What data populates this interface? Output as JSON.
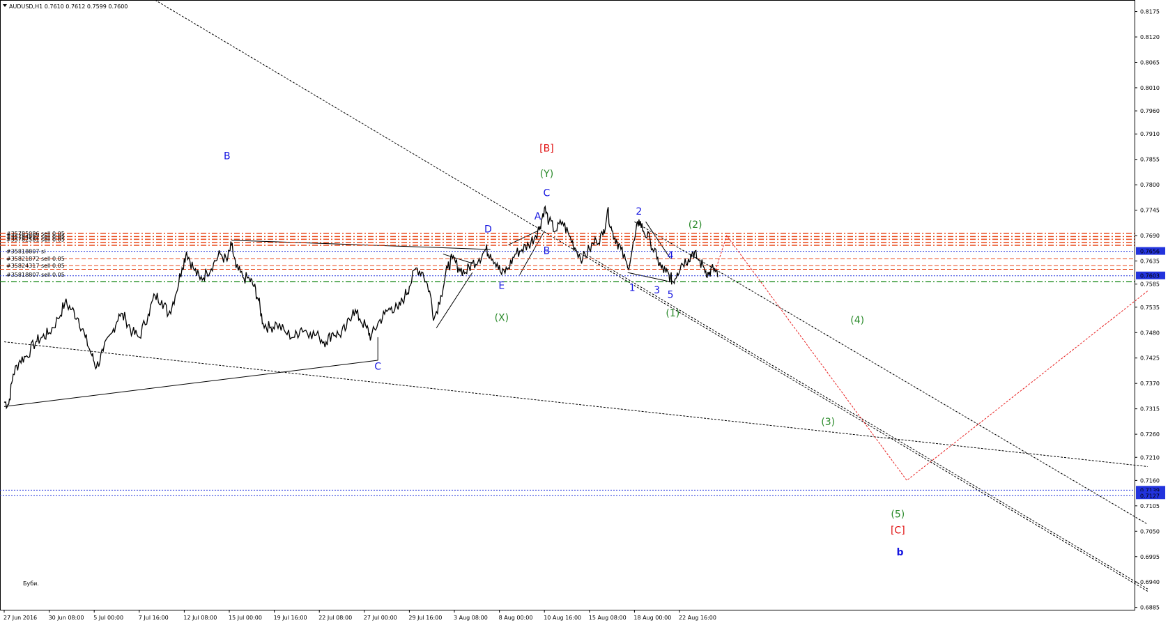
{
  "title": "AUDUSD,H1  0.7610 0.7612 0.7599 0.7600",
  "footer_note": "Буби.",
  "colors": {
    "background": "#ffffff",
    "price": "#000000",
    "blue_label": "#1515e0",
    "green_label": "#2a8a2a",
    "red_label": "#e01010",
    "order_line": "#e8481a",
    "sl_line": "#2233dd",
    "price_badge": "#2233dd",
    "green_dash": "#1a8a1a",
    "projection": "#e82020"
  },
  "chart_data": {
    "type": "line",
    "symbol": "AUDUSD",
    "timeframe": "H1",
    "ohlc": {
      "open": 0.761,
      "high": 0.7612,
      "low": 0.7599,
      "close": 0.76
    },
    "ylim": [
      0.688,
      0.82
    ],
    "grid": false,
    "y_ticks": [
      "0.8175",
      "0.8120",
      "0.8065",
      "0.8010",
      "0.7960",
      "0.7910",
      "0.7855",
      "0.7800",
      "0.7745",
      "0.7690",
      "0.7635",
      "0.7585",
      "0.7535",
      "0.7480",
      "0.7425",
      "0.7370",
      "0.7315",
      "0.7260",
      "0.7210",
      "0.7160",
      "0.7105",
      "0.7050",
      "0.6995",
      "0.6940",
      "0.6885"
    ],
    "x_ticks": [
      {
        "label": "27 Jun 2016",
        "t": 0
      },
      {
        "label": "30 Jun 08:00",
        "t": 1
      },
      {
        "label": "5 Jul 00:00",
        "t": 2
      },
      {
        "label": "7 Jul 16:00",
        "t": 3
      },
      {
        "label": "12 Jul 08:00",
        "t": 4
      },
      {
        "label": "15 Jul 00:00",
        "t": 5
      },
      {
        "label": "19 Jul 16:00",
        "t": 6
      },
      {
        "label": "22 Jul 08:00",
        "t": 7
      },
      {
        "label": "27 Jul 00:00",
        "t": 8
      },
      {
        "label": "29 Jul 16:00",
        "t": 9
      },
      {
        "label": "3 Aug 08:00",
        "t": 10
      },
      {
        "label": "8 Aug 00:00",
        "t": 11
      },
      {
        "label": "10 Aug 16:00",
        "t": 12
      },
      {
        "label": "15 Aug 08:00",
        "t": 13
      },
      {
        "label": "18 Aug 00:00",
        "t": 14
      },
      {
        "label": "22 Aug 16:00",
        "t": 15
      }
    ],
    "price_path": [
      [
        0.0,
        0.733
      ],
      [
        0.1,
        0.7325
      ],
      [
        0.2,
        0.739
      ],
      [
        0.35,
        0.742
      ],
      [
        0.5,
        0.743
      ],
      [
        0.7,
        0.746
      ],
      [
        0.85,
        0.747
      ],
      [
        1.0,
        0.748
      ],
      [
        1.2,
        0.751
      ],
      [
        1.35,
        0.7545
      ],
      [
        1.5,
        0.753
      ],
      [
        1.65,
        0.751
      ],
      [
        1.8,
        0.747
      ],
      [
        1.95,
        0.743
      ],
      [
        2.05,
        0.7405
      ],
      [
        2.2,
        0.744
      ],
      [
        2.4,
        0.748
      ],
      [
        2.55,
        0.752
      ],
      [
        2.7,
        0.751
      ],
      [
        2.85,
        0.748
      ],
      [
        3.0,
        0.747
      ],
      [
        3.2,
        0.752
      ],
      [
        3.35,
        0.756
      ],
      [
        3.5,
        0.755
      ],
      [
        3.65,
        0.752
      ],
      [
        3.8,
        0.756
      ],
      [
        3.95,
        0.762
      ],
      [
        4.05,
        0.7655
      ],
      [
        4.2,
        0.762
      ],
      [
        4.35,
        0.7595
      ],
      [
        4.5,
        0.761
      ],
      [
        4.65,
        0.763
      ],
      [
        4.8,
        0.765
      ],
      [
        4.95,
        0.7635
      ],
      [
        5.05,
        0.767
      ],
      [
        5.15,
        0.762
      ],
      [
        5.3,
        0.76
      ],
      [
        5.45,
        0.7595
      ],
      [
        5.55,
        0.758
      ],
      [
        5.65,
        0.755
      ],
      [
        5.75,
        0.75
      ],
      [
        5.9,
        0.749
      ],
      [
        6.05,
        0.75
      ],
      [
        6.25,
        0.748
      ],
      [
        6.45,
        0.747
      ],
      [
        6.6,
        0.749
      ],
      [
        6.8,
        0.748
      ],
      [
        7.0,
        0.747
      ],
      [
        7.15,
        0.746
      ],
      [
        7.3,
        0.748
      ],
      [
        7.45,
        0.7475
      ],
      [
        7.6,
        0.749
      ],
      [
        7.75,
        0.753
      ],
      [
        7.9,
        0.751
      ],
      [
        8.05,
        0.749
      ],
      [
        8.15,
        0.747
      ],
      [
        8.3,
        0.75
      ],
      [
        8.45,
        0.752
      ],
      [
        8.6,
        0.7535
      ],
      [
        8.75,
        0.753
      ],
      [
        8.9,
        0.756
      ],
      [
        9.0,
        0.758
      ],
      [
        9.15,
        0.762
      ],
      [
        9.3,
        0.761
      ],
      [
        9.45,
        0.757
      ],
      [
        9.55,
        0.751
      ],
      [
        9.7,
        0.756
      ],
      [
        9.85,
        0.762
      ],
      [
        9.95,
        0.764
      ],
      [
        10.1,
        0.762
      ],
      [
        10.25,
        0.761
      ],
      [
        10.4,
        0.763
      ],
      [
        10.55,
        0.764
      ],
      [
        10.7,
        0.766
      ],
      [
        10.8,
        0.765
      ],
      [
        10.95,
        0.763
      ],
      [
        11.05,
        0.7605
      ],
      [
        11.2,
        0.762
      ],
      [
        11.35,
        0.765
      ],
      [
        11.5,
        0.766
      ],
      [
        11.65,
        0.767
      ],
      [
        11.8,
        0.769
      ],
      [
        11.9,
        0.771
      ],
      [
        12.0,
        0.775
      ],
      [
        12.1,
        0.772
      ],
      [
        12.25,
        0.77
      ],
      [
        12.4,
        0.772
      ],
      [
        12.55,
        0.769
      ],
      [
        12.7,
        0.766
      ],
      [
        12.85,
        0.764
      ],
      [
        13.0,
        0.766
      ],
      [
        13.15,
        0.768
      ],
      [
        13.3,
        0.769
      ],
      [
        13.4,
        0.7745
      ],
      [
        13.5,
        0.77
      ],
      [
        13.6,
        0.768
      ],
      [
        13.7,
        0.766
      ],
      [
        13.85,
        0.762
      ],
      [
        14.0,
        0.768
      ],
      [
        14.1,
        0.7725
      ],
      [
        14.2,
        0.77
      ],
      [
        14.35,
        0.768
      ],
      [
        14.5,
        0.764
      ],
      [
        14.6,
        0.762
      ],
      [
        14.7,
        0.761
      ],
      [
        14.8,
        0.76
      ],
      [
        14.85,
        0.759
      ],
      [
        14.95,
        0.761
      ],
      [
        15.05,
        0.763
      ],
      [
        15.2,
        0.764
      ],
      [
        15.3,
        0.7655
      ],
      [
        15.4,
        0.764
      ],
      [
        15.55,
        0.762
      ],
      [
        15.65,
        0.7605
      ],
      [
        15.75,
        0.762
      ],
      [
        15.85,
        0.76
      ]
    ],
    "horizontal_lines": [
      {
        "kind": "order",
        "price": 0.7695,
        "style": "dashdot"
      },
      {
        "kind": "order",
        "price": 0.7688,
        "style": "dashdot"
      },
      {
        "kind": "order",
        "price": 0.7682,
        "style": "dashdot"
      },
      {
        "kind": "order",
        "price": 0.7675,
        "style": "dashdot"
      },
      {
        "kind": "order",
        "price": 0.7669,
        "style": "dashdot"
      },
      {
        "kind": "order",
        "price": 0.764,
        "style": "dash"
      },
      {
        "kind": "order",
        "price": 0.7625,
        "style": "dash"
      },
      {
        "kind": "order",
        "price": 0.7617,
        "style": "dash"
      },
      {
        "kind": "sl",
        "price": 0.7656,
        "style": "dot"
      },
      {
        "kind": "sl",
        "price": 0.7603,
        "style": "dot"
      },
      {
        "kind": "green",
        "price": 0.759,
        "style": "dashdot"
      },
      {
        "kind": "sl",
        "price": 0.7139,
        "style": "dot"
      },
      {
        "kind": "sl",
        "price": 0.7127,
        "style": "dot"
      }
    ],
    "price_badges": [
      {
        "label": "0.7656",
        "price": 0.7656
      },
      {
        "label": "0.7603",
        "price": 0.7603
      },
      {
        "label": "0.7139",
        "price": 0.7139
      },
      {
        "label": "0.7127",
        "price": 0.7127
      }
    ],
    "order_labels": [
      {
        "text": "#35785086 sell 0.05",
        "price": 0.7695
      },
      {
        "text": "#35784992 sell 0.05",
        "price": 0.7688
      },
      {
        "text": "#35782581 sell 0.05",
        "price": 0.7682
      },
      {
        "text": "#35818807 sl",
        "price": 0.7656
      },
      {
        "text": "#35821872 sell 0.05",
        "price": 0.764
      },
      {
        "text": "#35824317 sell 0.05",
        "price": 0.7625
      },
      {
        "text": "#35818807 sell 0.05",
        "price": 0.7606
      }
    ],
    "wave_labels": [
      {
        "text": "B",
        "t": 4.95,
        "price": 0.7855,
        "color": "blue_label"
      },
      {
        "text": "C",
        "t": 8.3,
        "price": 0.74,
        "color": "blue_label"
      },
      {
        "text": "D",
        "t": 10.75,
        "price": 0.7697,
        "color": "blue_label"
      },
      {
        "text": "E",
        "t": 11.05,
        "price": 0.7575,
        "color": "blue_label"
      },
      {
        "text": "(X)",
        "t": 11.05,
        "price": 0.7505,
        "color": "green_label"
      },
      {
        "text": "A",
        "t": 11.85,
        "price": 0.7725,
        "color": "blue_label"
      },
      {
        "text": "B",
        "t": 12.05,
        "price": 0.765,
        "color": "blue_label"
      },
      {
        "text": "C",
        "t": 12.05,
        "price": 0.7775,
        "color": "blue_label"
      },
      {
        "text": "(Y)",
        "t": 12.05,
        "price": 0.7817,
        "color": "green_label"
      },
      {
        "text": "[B]",
        "t": 12.05,
        "price": 0.7872,
        "color": "red_label"
      },
      {
        "text": "1",
        "t": 13.95,
        "price": 0.757,
        "color": "blue_label"
      },
      {
        "text": "2",
        "t": 14.1,
        "price": 0.7735,
        "color": "blue_label"
      },
      {
        "text": "3",
        "t": 14.5,
        "price": 0.7565,
        "color": "blue_label"
      },
      {
        "text": "4",
        "t": 14.8,
        "price": 0.764,
        "color": "blue_label"
      },
      {
        "text": "5",
        "t": 14.8,
        "price": 0.7555,
        "color": "blue_label"
      },
      {
        "text": "(1)",
        "t": 14.85,
        "price": 0.7515,
        "color": "green_label"
      },
      {
        "text": "(2)",
        "t": 15.35,
        "price": 0.7707,
        "color": "green_label"
      },
      {
        "text": "(4)",
        "t": 18.95,
        "price": 0.75,
        "color": "green_label"
      },
      {
        "text": "(3)",
        "t": 18.3,
        "price": 0.728,
        "color": "green_label"
      },
      {
        "text": "(5)",
        "t": 19.85,
        "price": 0.708,
        "color": "green_label"
      },
      {
        "text": "[C]",
        "t": 19.85,
        "price": 0.7045,
        "color": "red_label"
      },
      {
        "text": "b",
        "t": 19.9,
        "price": 0.6998,
        "color": "blue_label"
      }
    ],
    "trendlines": [
      {
        "style": "dotted",
        "from": [
          3.35,
          0.82
        ],
        "to": [
          25.4,
          0.692
        ]
      },
      {
        "style": "dotted",
        "from": [
          0.0,
          0.746
        ],
        "to": [
          25.4,
          0.719
        ]
      },
      {
        "style": "dotted",
        "from": [
          14.0,
          0.772
        ],
        "to": [
          25.4,
          0.7065
        ]
      },
      {
        "style": "dotted",
        "from": [
          13.0,
          0.7645
        ],
        "to": [
          25.4,
          0.6925
        ]
      },
      {
        "style": "solid",
        "from": [
          0.0,
          0.732
        ],
        "to": [
          8.3,
          0.742
        ]
      },
      {
        "style": "solid",
        "from": [
          5.05,
          0.768
        ],
        "to": [
          10.8,
          0.766
        ]
      },
      {
        "style": "solid",
        "from": [
          9.6,
          0.749
        ],
        "to": [
          10.4,
          0.761
        ]
      },
      {
        "style": "solid",
        "from": [
          9.75,
          0.765
        ],
        "to": [
          10.4,
          0.763
        ]
      },
      {
        "style": "solid",
        "from": [
          11.45,
          0.7605
        ],
        "to": [
          12.0,
          0.77
        ]
      },
      {
        "style": "solid",
        "from": [
          11.2,
          0.767
        ],
        "to": [
          11.85,
          0.77
        ]
      },
      {
        "style": "solid",
        "from": [
          13.85,
          0.761
        ],
        "to": [
          14.8,
          0.759
        ]
      },
      {
        "style": "solid",
        "from": [
          14.25,
          0.772
        ],
        "to": [
          14.8,
          0.764
        ]
      },
      {
        "style": "solid",
        "from": [
          8.3,
          0.742
        ],
        "to": [
          8.3,
          0.747
        ]
      }
    ],
    "projection": [
      [
        15.8,
        0.7615
      ],
      [
        16.05,
        0.769
      ],
      [
        20.05,
        0.716
      ],
      [
        25.4,
        0.757
      ]
    ]
  }
}
